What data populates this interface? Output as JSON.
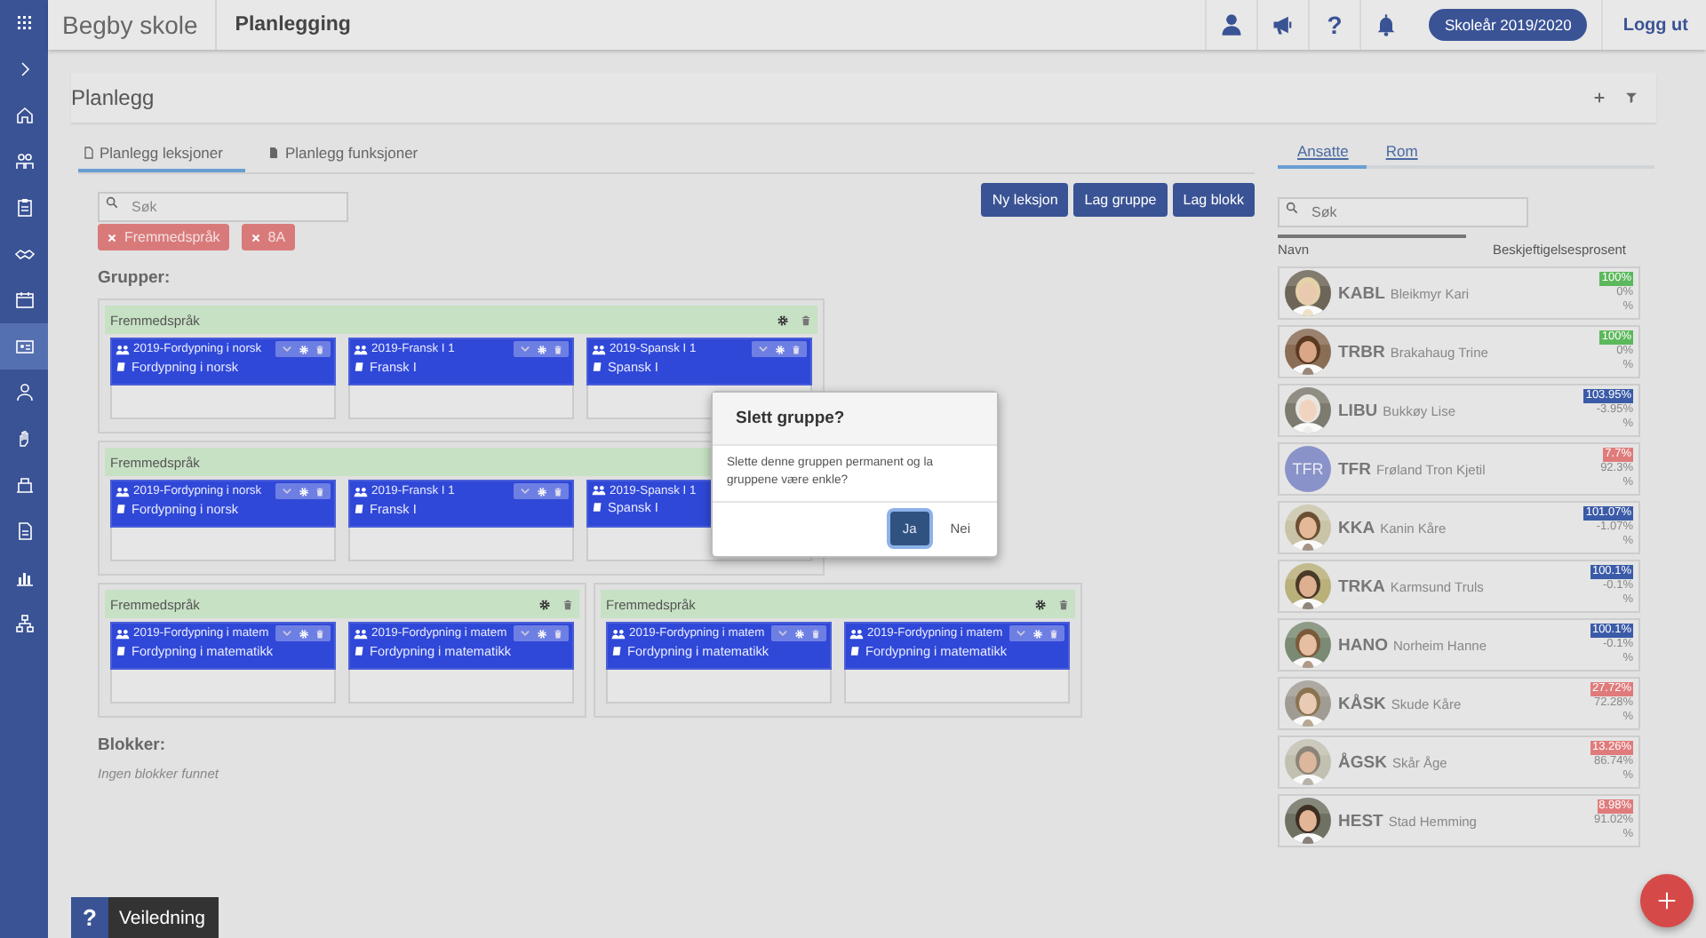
{
  "sidebar": {
    "items": [
      {
        "selected": false
      },
      {
        "selected": false
      },
      {
        "selected": false
      },
      {
        "selected": false
      },
      {
        "selected": false
      },
      {
        "selected": true
      },
      {
        "selected": false
      },
      {
        "selected": false
      },
      {
        "selected": false
      },
      {
        "selected": false
      },
      {
        "selected": false
      },
      {
        "selected": false
      }
    ]
  },
  "header": {
    "school": "Begby skole",
    "module": "Planlegging",
    "help": "?",
    "year_button": "Skoleår 2019/2020",
    "logout": "Logg ut"
  },
  "panel": {
    "title": "Planlegg"
  },
  "tabs": [
    {
      "label": "Planlegg leksjoner",
      "selected": true
    },
    {
      "label": "Planlegg funksjoner",
      "selected": false
    }
  ],
  "search": {
    "placeholder": "Søk"
  },
  "filters": [
    {
      "label": "Fremmedspråk"
    },
    {
      "label": "8A"
    }
  ],
  "actions": [
    "Ny leksjon",
    "Lag gruppe",
    "Lag blokk"
  ],
  "groups_label": "Grupper:",
  "groups": [
    {
      "title": "Fremmedspråk",
      "tools": true,
      "cards": [
        {
          "title": "2019-Fordypning i norsk",
          "subject": "Fordypning i norsk",
          "tools": true
        },
        {
          "title": "2019-Fransk I 1",
          "subject": "Fransk I",
          "tools": true
        },
        {
          "title": "2019-Spansk I 1",
          "subject": "Spansk I",
          "tools": true
        }
      ]
    },
    {
      "title": "Fremmedspråk",
      "tools": false,
      "cards": [
        {
          "title": "2019-Fordypning i norsk",
          "subject": "Fordypning i norsk",
          "tools": true
        },
        {
          "title": "2019-Fransk I 1",
          "subject": "Fransk I",
          "tools": true
        },
        {
          "title": "2019-Spansk I 1",
          "subject": "Spansk I",
          "tools": false
        }
      ]
    },
    {
      "title": "Fremmedspråk",
      "tools": true,
      "cards": [
        {
          "title": "2019-Fordypning i matem",
          "subject": "Fordypning i matematikk",
          "tools": true
        },
        {
          "title": "2019-Fordypning i matem",
          "subject": "Fordypning i matematikk",
          "tools": true
        }
      ]
    },
    {
      "title": "Fremmedspråk",
      "tools": true,
      "cards": [
        {
          "title": "2019-Fordypning i matem",
          "subject": "Fordypning i matematikk",
          "tools": true
        },
        {
          "title": "2019-Fordypning i matem",
          "subject": "Fordypning i matematikk",
          "tools": true
        }
      ]
    }
  ],
  "blocks_label": "Blokker:",
  "blocks_empty": "Ingen blokker funnet",
  "dialog": {
    "title": "Slett gruppe?",
    "message": "Slette denne gruppen permanent og la gruppene være enkle?",
    "buttons": [
      {
        "label": "Ja",
        "selected": true
      },
      {
        "label": "Nei",
        "selected": false
      }
    ]
  },
  "staff": {
    "tabs": [
      {
        "label": "Ansatte",
        "selected": true
      },
      {
        "label": "Rom",
        "selected": false
      }
    ],
    "search_placeholder": "Søk",
    "columns": [
      "Navn",
      "Beskjeftigelsesprosent"
    ],
    "rows": [
      {
        "kind": "picture",
        "code": "KABL",
        "name": "Bleikmyr Kari",
        "percent": "100%",
        "color": "#5cb85c",
        "rest": "0%",
        "unit": "%"
      },
      {
        "kind": "picture",
        "code": "TRBR",
        "name": "Brakahaug Trine",
        "percent": "100%",
        "color": "#5cb85c",
        "rest": "0%",
        "unit": "%"
      },
      {
        "kind": "picture",
        "code": "LIBU",
        "name": "Bukkøy Lise",
        "percent": "103.95%",
        "color": "#3b5ba8",
        "rest": "-3.95%",
        "unit": "%"
      },
      {
        "kind": "initials",
        "initials": "TFR",
        "code": "TFR",
        "name": "Frøland Tron Kjetil",
        "percent": "7.7%",
        "color": "#e07b7b",
        "rest": "92.3%",
        "unit": "%"
      },
      {
        "kind": "picture",
        "code": "KKA",
        "name": "Kanin Kåre",
        "percent": "101.07%",
        "color": "#3b5ba8",
        "rest": "-1.07%",
        "unit": "%"
      },
      {
        "kind": "picture",
        "code": "TRKA",
        "name": "Karmsund Truls",
        "percent": "100.1%",
        "color": "#3b5ba8",
        "rest": "-0.1%",
        "unit": "%"
      },
      {
        "kind": "picture",
        "code": "HANO",
        "name": "Norheim Hanne",
        "percent": "100.1%",
        "color": "#3b5ba8",
        "rest": "-0.1%",
        "unit": "%"
      },
      {
        "kind": "picture",
        "code": "KÅSK",
        "name": "Skude Kåre",
        "percent": "27.72%",
        "color": "#e07b7b",
        "rest": "72.28%",
        "unit": "%"
      },
      {
        "kind": "picture",
        "code": "ÅGSK",
        "name": "Skår Åge",
        "percent": "13.26%",
        "color": "#e07b7b",
        "rest": "86.74%",
        "unit": "%"
      },
      {
        "kind": "picture",
        "code": "HEST",
        "name": "Stad Hemming",
        "percent": "8.98%",
        "color": "#e07b7b",
        "rest": "91.02%",
        "unit": "%"
      }
    ]
  },
  "help_button": {
    "icon": "?",
    "label": "Veiledning"
  }
}
